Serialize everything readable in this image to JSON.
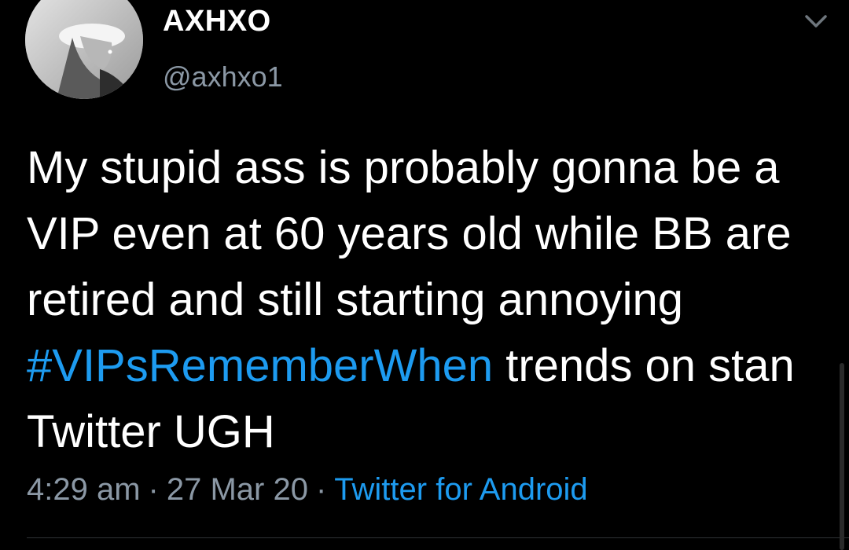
{
  "tweet": {
    "author": {
      "display_name": "AXHXO",
      "handle": "@axhxo1"
    },
    "text_before": "My stupid ass is probably gonna be a VIP even at 60 years old while BB are retired and still starting annoying ",
    "hashtag": "#VIPsRememberWhen",
    "text_after": " trends on stan Twitter UGH",
    "time": "4:29 am",
    "separator": "·",
    "date": "27 Mar 20",
    "source": "Twitter for Android"
  },
  "colors": {
    "background": "#000000",
    "link": "#1d9bf0",
    "muted": "#8b98a5",
    "text": "#ffffff"
  },
  "icons": {
    "menu": "chevron-down-icon",
    "avatar": "profile-avatar"
  }
}
